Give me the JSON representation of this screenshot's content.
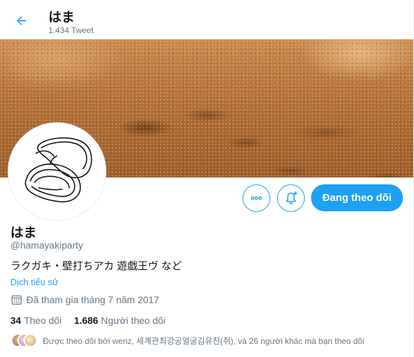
{
  "header": {
    "title": "はま",
    "tweet_count": "1.434 Tweet"
  },
  "profile": {
    "display_name": "はま",
    "handle": "@hamayakiparty",
    "bio": "ラクガキ・壁打ちアカ 遊戯王ヴ など",
    "translate_link": "Dịch tiểu sử",
    "joined": "Đã tham gia tháng 7 năm 2017",
    "following_count": "34",
    "following_label": "Theo dõi",
    "followers_count": "1.686",
    "followers_label": "Người theo dõi",
    "followed_by": "Được theo dõi bởi wenz, 세계관최강공얼굴김유찬(쥐), và 26 người khác mà bạn theo dõi"
  },
  "actions": {
    "follow_label": "Đang theo dõi"
  },
  "icons": {
    "back": "arrow-left-icon",
    "more": "more-dots-icon",
    "notify": "bell-plus-icon",
    "calendar": "calendar-icon"
  },
  "colors": {
    "accent": "#1da1f2",
    "text": "#14171a",
    "muted": "#657786"
  }
}
